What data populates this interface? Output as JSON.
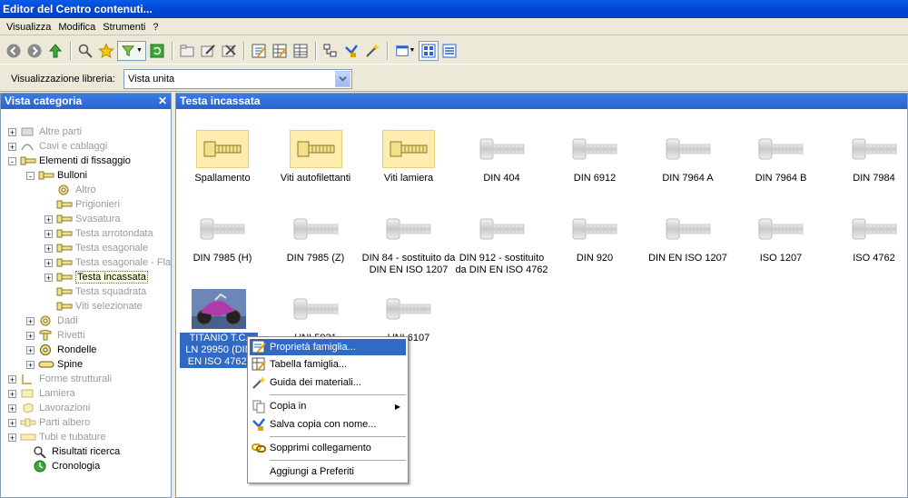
{
  "window": {
    "title": "Editor del Centro contenuti..."
  },
  "menu": [
    "Visualizza",
    "Modifica",
    "Strumenti",
    "?"
  ],
  "library": {
    "label": "Visualizzazione libreria:",
    "value": "Vista unita"
  },
  "left_pane": {
    "title": "Vista categoria",
    "tree": [
      {
        "label": "Altre parti",
        "muted": true
      },
      {
        "label": "Cavi e cablaggi",
        "muted": true
      },
      {
        "label": "Elementi di fissaggio",
        "muted": false
      },
      {
        "label": "Bulloni",
        "muted": false
      },
      {
        "label": "Altro",
        "muted": true
      },
      {
        "label": "Prigionieri",
        "muted": true
      },
      {
        "label": "Svasatura",
        "muted": true
      },
      {
        "label": "Testa arrotondata",
        "muted": true
      },
      {
        "label": "Testa esagonale",
        "muted": true
      },
      {
        "label": "Testa esagonale - Flar",
        "muted": true
      },
      {
        "label": "Testa incassata",
        "muted": false
      },
      {
        "label": "Testa squadrata",
        "muted": true
      },
      {
        "label": "Viti selezionate",
        "muted": true
      },
      {
        "label": "Dadi",
        "muted": true
      },
      {
        "label": "Rivetti",
        "muted": true
      },
      {
        "label": "Rondelle",
        "muted": false
      },
      {
        "label": "Spine",
        "muted": false
      },
      {
        "label": "Forme strutturali",
        "muted": true
      },
      {
        "label": "Lamiera",
        "muted": true
      },
      {
        "label": "Lavorazioni",
        "muted": true
      },
      {
        "label": "Parti albero",
        "muted": true
      },
      {
        "label": "Tubi e tubature",
        "muted": true
      },
      {
        "label": "Risultati ricerca",
        "muted": false
      },
      {
        "label": "Cronologia",
        "muted": false
      }
    ]
  },
  "right_pane": {
    "title": "Testa incassata",
    "items": [
      {
        "label": "Spallamento",
        "kind": "folder"
      },
      {
        "label": "Viti autofilettanti",
        "kind": "folder"
      },
      {
        "label": "Viti lamiera",
        "kind": "folder"
      },
      {
        "label": "DIN 404",
        "kind": "screw"
      },
      {
        "label": "DIN 6912",
        "kind": "screw"
      },
      {
        "label": "DIN 7964 A",
        "kind": "screw"
      },
      {
        "label": "DIN 7964 B",
        "kind": "screw"
      },
      {
        "label": "DIN 7984",
        "kind": "screw"
      },
      {
        "label": "DIN 7985 (H)",
        "kind": "screw"
      },
      {
        "label": "DIN 7985 (Z)",
        "kind": "screw"
      },
      {
        "label": "DIN 84 - sostituito da DIN EN ISO 1207",
        "kind": "screw"
      },
      {
        "label": "DIN 912 - sostituito da DIN EN ISO 4762",
        "kind": "screw"
      },
      {
        "label": "DIN 920",
        "kind": "screw"
      },
      {
        "label": "DIN EN ISO 1207",
        "kind": "screw"
      },
      {
        "label": "ISO 1207",
        "kind": "screw"
      },
      {
        "label": "ISO 4762",
        "kind": "screw"
      },
      {
        "label": "TITANIO T.C. LN 29950 (DIN EN ISO 4762)",
        "kind": "photo"
      },
      {
        "label": "UNI 5931",
        "kind": "screw"
      },
      {
        "label": "UNI 6107",
        "kind": "screw"
      }
    ]
  },
  "context_menu": [
    {
      "label": "Proprietà famiglia...",
      "icon": "properties-icon"
    },
    {
      "label": "Tabella famiglia...",
      "icon": "table-icon"
    },
    {
      "label": "Guida dei materiali...",
      "icon": "wand-icon"
    },
    {
      "label": "Copia in",
      "icon": "copy-icon"
    },
    {
      "label": "Salva copia con nome...",
      "icon": "save-copy-icon"
    },
    {
      "label": "Sopprimi collegamento",
      "icon": "link-icon"
    },
    {
      "label": "Aggiungi a Preferiti",
      "icon": ""
    }
  ]
}
